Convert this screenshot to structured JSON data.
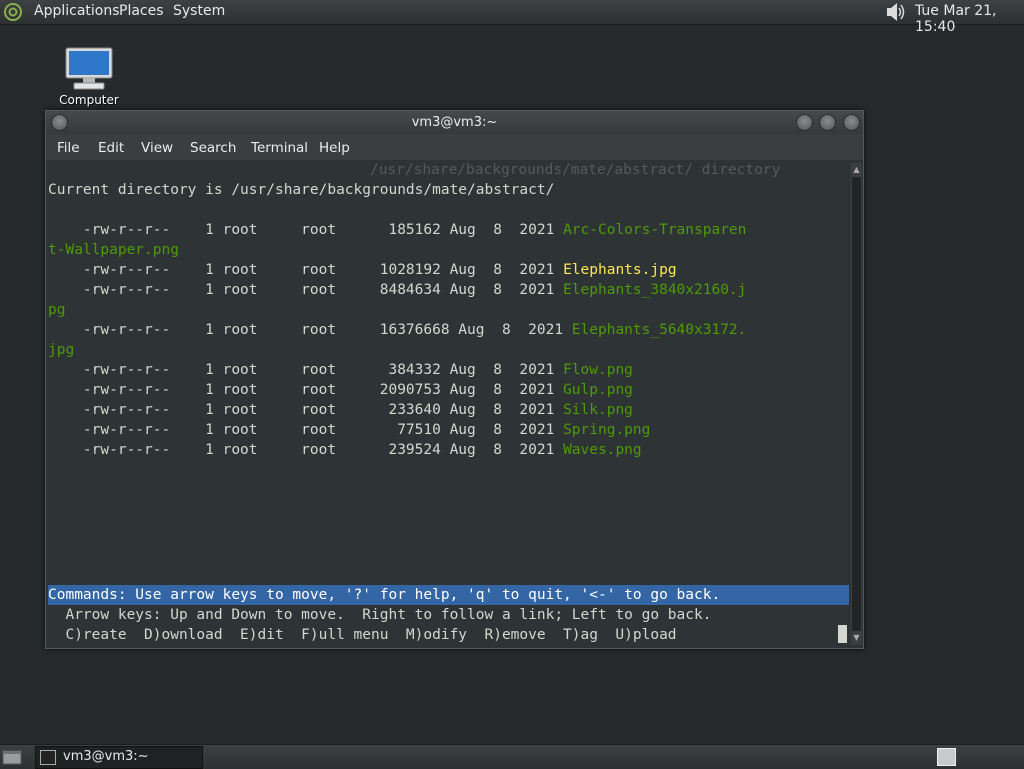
{
  "top_panel": {
    "menus": [
      "Applications",
      "Places",
      "System"
    ],
    "clock": "Tue Mar 21, 15:40"
  },
  "desktop": {
    "computer_label": "Computer"
  },
  "window": {
    "title": "vm3@vm3:~",
    "menus": [
      "File",
      "Edit",
      "View",
      "Search",
      "Terminal",
      "Help"
    ]
  },
  "terminal": {
    "ghost_line": "/usr/share/backgrounds/mate/abstract/ directory",
    "current_dir": "Current directory is /usr/share/backgrounds/mate/abstract/",
    "rows": [
      {
        "lead": "    -rw-r--r--    1 root     root      185162 Aug  8  2021 ",
        "name": "Arc-Colors-Transparen",
        "wrap": "t-Wallpaper.png",
        "style": "green"
      },
      {
        "lead": "    -rw-r--r--    1 root     root     1028192 Aug  8  2021 ",
        "name": "Elephants.jpg",
        "wrap": "",
        "style": "yellow"
      },
      {
        "lead": "    -rw-r--r--    1 root     root     8484634 Aug  8  2021 ",
        "name": "Elephants_3840x2160.j",
        "wrap": "pg",
        "style": "green"
      },
      {
        "lead": "    -rw-r--r--    1 root     root     16376668 Aug  8  2021 ",
        "name": "Elephants_5640x3172.",
        "wrap": "jpg",
        "style": "green"
      },
      {
        "lead": "    -rw-r--r--    1 root     root      384332 Aug  8  2021 ",
        "name": "Flow.png",
        "wrap": "",
        "style": "green"
      },
      {
        "lead": "    -rw-r--r--    1 root     root     2090753 Aug  8  2021 ",
        "name": "Gulp.png",
        "wrap": "",
        "style": "green"
      },
      {
        "lead": "    -rw-r--r--    1 root     root      233640 Aug  8  2021 ",
        "name": "Silk.png",
        "wrap": "",
        "style": "green"
      },
      {
        "lead": "    -rw-r--r--    1 root     root       77510 Aug  8  2021 ",
        "name": "Spring.png",
        "wrap": "",
        "style": "green"
      },
      {
        "lead": "    -rw-r--r--    1 root     root      239524 Aug  8  2021 ",
        "name": "Waves.png",
        "wrap": "",
        "style": "green"
      }
    ],
    "commands_line": "Commands: Use arrow keys to move, '?' for help, 'q' to quit, '<-' to go back.",
    "arrow_help": "  Arrow keys: Up and Down to move.  Right to follow a link; Left to go back.",
    "options_line": "  C)reate  D)ownload  E)dit  F)ull menu  M)odify  R)emove  T)ag  U)pload"
  },
  "taskbar": {
    "task_label": "vm3@vm3:~"
  },
  "colors": {
    "file_green": "#4e9a06",
    "selected_yellow": "#fce94f",
    "command_bar": "#3465a4"
  }
}
